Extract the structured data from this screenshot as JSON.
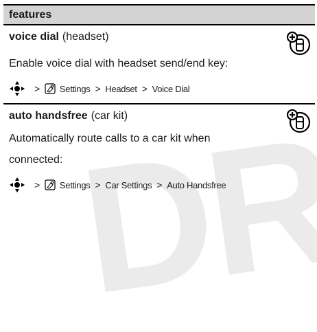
{
  "watermark": "DRAFT",
  "header": {
    "title": "features"
  },
  "sections": [
    {
      "title_bold": "voice dial",
      "title_rest": "(headset)",
      "lines": [
        "Enable voice dial with headset send/end key:"
      ],
      "path": [
        "Settings",
        "Headset",
        "Voice Dial"
      ],
      "icon": "network-dependent-phone-icon"
    },
    {
      "title_bold": "auto handsfree",
      "title_rest": "(car kit)",
      "lines": [
        "Automatically route calls to a car kit when",
        "connected:"
      ],
      "path": [
        "Settings",
        "Car Settings",
        "Auto Handsfree"
      ],
      "icon": "network-dependent-phone-icon"
    }
  ],
  "separator": ">"
}
